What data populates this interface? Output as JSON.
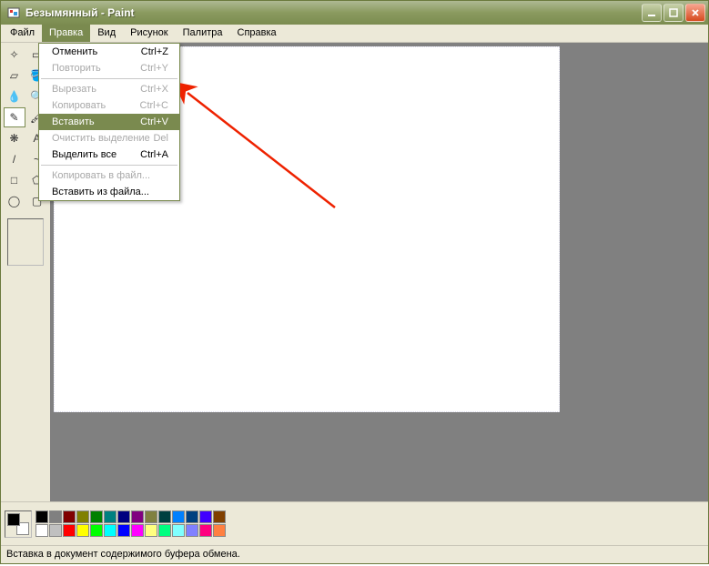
{
  "window": {
    "title": "Безымянный - Paint"
  },
  "menubar": {
    "items": [
      {
        "label": "Файл"
      },
      {
        "label": "Правка"
      },
      {
        "label": "Вид"
      },
      {
        "label": "Рисунок"
      },
      {
        "label": "Палитра"
      },
      {
        "label": "Справка"
      }
    ],
    "open_index": 1
  },
  "dropdown": {
    "items": [
      {
        "label": "Отменить",
        "shortcut": "Ctrl+Z",
        "disabled": false
      },
      {
        "label": "Повторить",
        "shortcut": "Ctrl+Y",
        "disabled": true
      },
      {
        "sep": true
      },
      {
        "label": "Вырезать",
        "shortcut": "Ctrl+X",
        "disabled": true
      },
      {
        "label": "Копировать",
        "shortcut": "Ctrl+C",
        "disabled": true
      },
      {
        "label": "Вставить",
        "shortcut": "Ctrl+V",
        "disabled": false,
        "hover": true
      },
      {
        "label": "Очистить выделение",
        "shortcut": "Del",
        "disabled": true
      },
      {
        "label": "Выделить все",
        "shortcut": "Ctrl+A",
        "disabled": false
      },
      {
        "sep": true
      },
      {
        "label": "Копировать в файл...",
        "shortcut": "",
        "disabled": true
      },
      {
        "label": "Вставить из файла...",
        "shortcut": "",
        "disabled": false
      }
    ]
  },
  "tools": [
    "freeform-select-icon",
    "rect-select-icon",
    "eraser-icon",
    "fill-icon",
    "picker-icon",
    "magnifier-icon",
    "pencil-icon",
    "brush-icon",
    "airbrush-icon",
    "text-icon",
    "line-icon",
    "curve-icon",
    "rect-icon",
    "polygon-icon",
    "ellipse-icon",
    "roundrect-icon"
  ],
  "palette": [
    "#000000",
    "#ffffff",
    "#808080",
    "#c0c0c0",
    "#800000",
    "#ff0000",
    "#808000",
    "#ffff00",
    "#008000",
    "#00ff00",
    "#008080",
    "#00ffff",
    "#000080",
    "#0000ff",
    "#800080",
    "#ff00ff",
    "#808040",
    "#ffff80",
    "#004040",
    "#00ff80",
    "#0080ff",
    "#80ffff",
    "#004080",
    "#8080ff",
    "#4000ff",
    "#ff0080",
    "#804000",
    "#ff8040"
  ],
  "statusbar": {
    "text": "Вставка в документ содержимого буфера обмена."
  }
}
